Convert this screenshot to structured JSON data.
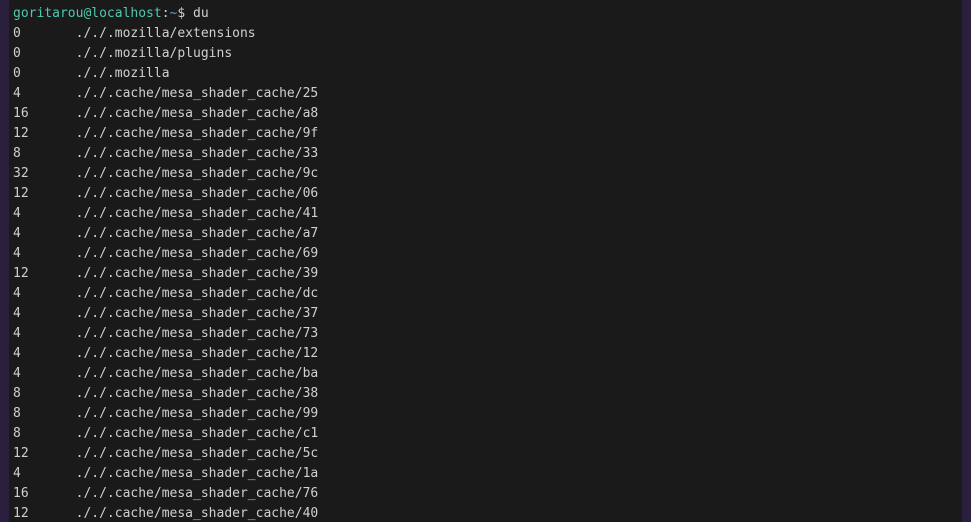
{
  "prompt": {
    "user_host": "goritarou@localhost",
    "colon": ":",
    "path": "~",
    "dollar": "$ ",
    "command": "du"
  },
  "output": [
    {
      "size": "0",
      "path": "././.mozilla/extensions"
    },
    {
      "size": "0",
      "path": "././.mozilla/plugins"
    },
    {
      "size": "0",
      "path": "././.mozilla"
    },
    {
      "size": "4",
      "path": "././.cache/mesa_shader_cache/25"
    },
    {
      "size": "16",
      "path": "././.cache/mesa_shader_cache/a8"
    },
    {
      "size": "12",
      "path": "././.cache/mesa_shader_cache/9f"
    },
    {
      "size": "8",
      "path": "././.cache/mesa_shader_cache/33"
    },
    {
      "size": "32",
      "path": "././.cache/mesa_shader_cache/9c"
    },
    {
      "size": "12",
      "path": "././.cache/mesa_shader_cache/06"
    },
    {
      "size": "4",
      "path": "././.cache/mesa_shader_cache/41"
    },
    {
      "size": "4",
      "path": "././.cache/mesa_shader_cache/a7"
    },
    {
      "size": "4",
      "path": "././.cache/mesa_shader_cache/69"
    },
    {
      "size": "12",
      "path": "././.cache/mesa_shader_cache/39"
    },
    {
      "size": "4",
      "path": "././.cache/mesa_shader_cache/dc"
    },
    {
      "size": "4",
      "path": "././.cache/mesa_shader_cache/37"
    },
    {
      "size": "4",
      "path": "././.cache/mesa_shader_cache/73"
    },
    {
      "size": "4",
      "path": "././.cache/mesa_shader_cache/12"
    },
    {
      "size": "4",
      "path": "././.cache/mesa_shader_cache/ba"
    },
    {
      "size": "8",
      "path": "././.cache/mesa_shader_cache/38"
    },
    {
      "size": "8",
      "path": "././.cache/mesa_shader_cache/99"
    },
    {
      "size": "8",
      "path": "././.cache/mesa_shader_cache/c1"
    },
    {
      "size": "12",
      "path": "././.cache/mesa_shader_cache/5c"
    },
    {
      "size": "4",
      "path": "././.cache/mesa_shader_cache/1a"
    },
    {
      "size": "16",
      "path": "././.cache/mesa_shader_cache/76"
    },
    {
      "size": "12",
      "path": "././.cache/mesa_shader_cache/40"
    }
  ]
}
